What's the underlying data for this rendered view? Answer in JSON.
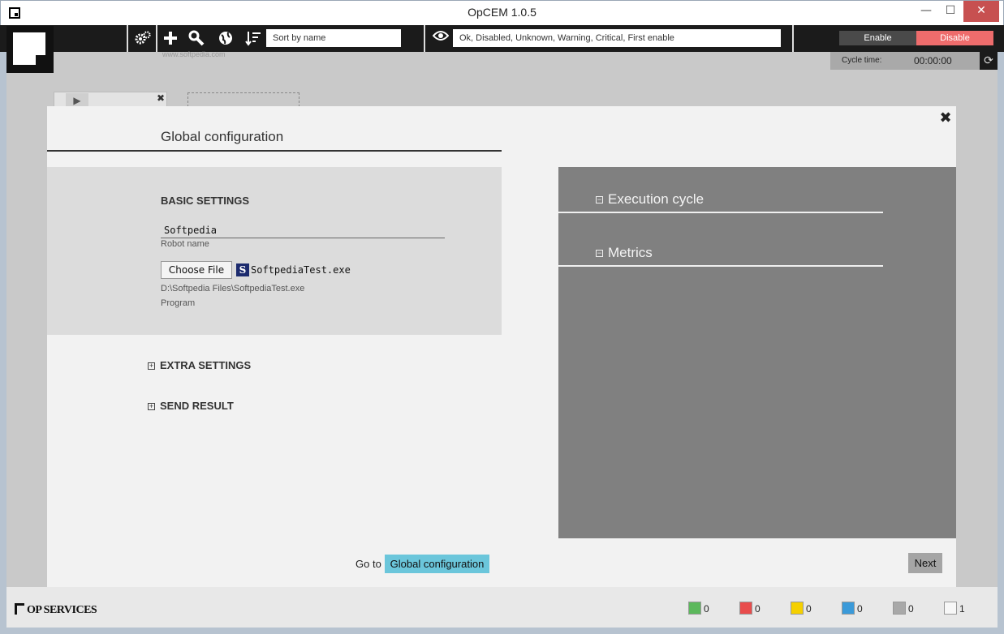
{
  "window": {
    "title": "OpCEM 1.0.5",
    "minimize": "—",
    "maximize": "☐",
    "close": "✕"
  },
  "toolbar": {
    "sort_placeholder": "Sort by name",
    "filter_value": "Ok, Disabled, Unknown, Warning, Critical, First enable",
    "enable_label": "Enable",
    "disable_label": "Disable",
    "icons": [
      "gears-icon",
      "plus-icon",
      "wrench-icon",
      "globe-icon",
      "sort-icon",
      "eye-icon"
    ]
  },
  "watermark": "www.softpedia.com",
  "cycle": {
    "label": "Cycle time:",
    "value": "00:00:00"
  },
  "modal": {
    "title": "Global configuration",
    "basic": {
      "heading": "BASIC SETTINGS",
      "robot_name_value": "Softpedia",
      "robot_name_label": "Robot name",
      "choose_file_label": "Choose File",
      "file_icon_letter": "S",
      "file_name": "SoftpediaTest.exe",
      "file_path": "D:\\Softpedia Files\\SoftpediaTest.exe",
      "program_label": "Program"
    },
    "extra_settings": "EXTRA SETTINGS",
    "send_result": "SEND RESULT",
    "right_sections": [
      "Execution cycle",
      "Metrics"
    ],
    "goto_label": "Go to",
    "goto_button": "Global configuration",
    "next_button": "Next"
  },
  "footer": {
    "brand": "OP SERVICES",
    "statuses": [
      {
        "color": "#5cb85c",
        "count": "0"
      },
      {
        "color": "#e84c4c",
        "count": "0"
      },
      {
        "color": "#f5d000",
        "count": "0"
      },
      {
        "color": "#3b9ad9",
        "count": "0"
      },
      {
        "color": "#a8a8a8",
        "count": "0"
      },
      {
        "color": "#f7f7f7",
        "count": "1"
      }
    ]
  }
}
